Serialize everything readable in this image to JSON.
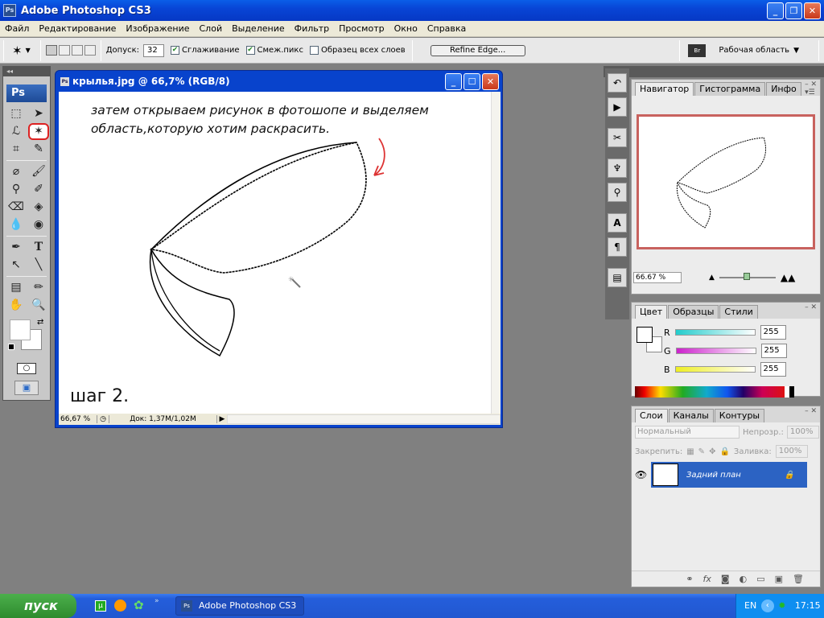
{
  "app": {
    "title": "Adobe Photoshop CS3",
    "logo": "Ps"
  },
  "menu": [
    "Файл",
    "Редактирование",
    "Изображение",
    "Слой",
    "Выделение",
    "Фильтр",
    "Просмотр",
    "Окно",
    "Справка"
  ],
  "options": {
    "tool_icon": "magic-wand-icon",
    "tolerance_label": "Допуск:",
    "tolerance_value": "32",
    "antialias_label": "Сглаживание",
    "antialias_checked": true,
    "contiguous_label": "Смеж.пикс",
    "contiguous_checked": true,
    "sample_all_label": "Образец всех слоев",
    "sample_all_checked": false,
    "refine_edge_label": "Refine Edge...",
    "workspace_label": "Рабочая область"
  },
  "toolbox": {
    "logo": "Ps",
    "selected_tool": "magic-wand"
  },
  "document": {
    "title": "крылья.jpg @ 66,7% (RGB/8)",
    "instruction_line1": "затем открываем рисунок в фотошопе и выделяем",
    "instruction_line2": "область,которую хотим раскрасить.",
    "step_label": "шаг 2.",
    "zoom": "66,67 %",
    "doc_size": "Док: 1,37M/1,02M"
  },
  "navigator": {
    "tabs": [
      "Навигатор",
      "Гистограмма",
      "Инфо"
    ],
    "active_tab": 0,
    "zoom": "66.67 %"
  },
  "color": {
    "tabs": [
      "Цвет",
      "Образцы",
      "Стили"
    ],
    "r_label": "R",
    "r_value": "255",
    "g_label": "G",
    "g_value": "255",
    "b_label": "B",
    "b_value": "255"
  },
  "layers": {
    "tabs": [
      "Слои",
      "Каналы",
      "Контуры"
    ],
    "blend_mode": "Нормальный",
    "opacity_label": "Непрозр.:",
    "opacity_value": "100%",
    "lock_label": "Закрепить:",
    "fill_label": "Заливка:",
    "fill_value": "100%",
    "items": [
      {
        "name": "Задний план",
        "locked": true,
        "visible": true
      }
    ]
  },
  "taskbar": {
    "start_label": "пуск",
    "task_label": "Adobe Photoshop CS3",
    "lang": "EN",
    "clock": "17:15"
  }
}
